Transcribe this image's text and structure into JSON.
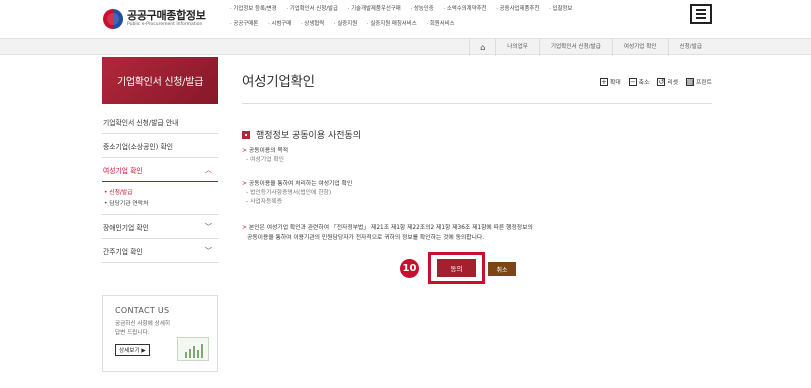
{
  "header": {
    "logo_kr": "공공구매종합정보",
    "logo_en": "Public e-Procurement Information",
    "gnb_row1": [
      "· 기업정보 등록/변경",
      "· 기업확인서 신청/발급",
      "· 기술개발제품우선구매",
      "· 성능인증",
      "· 소액수의계약추천",
      "· 공동사업제품추천",
      "· 입찰정보"
    ],
    "gnb_row2": [
      "· 공공구매론",
      "· 시범구매",
      "· 상생협력",
      "· 실증지원",
      "· 실증지원 매칭서비스",
      "· 회원서비스"
    ]
  },
  "breadcrumb": [
    "나의업무",
    "기업확인서 신청/발급",
    "여성기업 확인",
    "신청/발급"
  ],
  "sidebar": {
    "title": "기업확인서 신청/발급",
    "items": [
      {
        "label": "기업확인서 신청/발급 안내"
      },
      {
        "label": "중소기업(소상공인) 확인"
      },
      {
        "label": "여성기업 확인"
      },
      {
        "label": "장애인기업 확인"
      },
      {
        "label": "간주기업 확인"
      }
    ],
    "sub_items": [
      "• 신청/발급",
      "• 담당기관 연락처"
    ]
  },
  "contact": {
    "title": "CONTACT US",
    "desc": "궁금하신 사항에 상세히 답변 드립니다.",
    "button": "상세보기 ▶"
  },
  "main": {
    "title": "여성기업확인",
    "tools": [
      "확대",
      "축소",
      "리셋",
      "프린트"
    ],
    "section_title": "행정정보 공동이용 사전동의",
    "purpose_head": "공동이용의 목적",
    "purpose_detail": "여성기업 확인",
    "info_head": "공동이용을 통하여 처리하는 여성기업 확인",
    "info_detail_1": "법인등기사항증명서(법인에 한함)",
    "info_detail_2": "사업자등록증",
    "consent_line1": "본인은 여성기업 확인과 관련하여 「전자정부법」 제21조 제1항 제22조의2 제1항 제36조 제1항에 따른 행정정보의",
    "consent_line2": "공동이용을 통하여 이용기관의 민원담당자가 전자적으로 귀하의 정보를 확인하는 것에 동의합니다.",
    "step_number": "10",
    "agree_label": "동의",
    "cancel_label": "취소"
  },
  "colors": {
    "brand_red": "#c8102e",
    "agree_button": "#a5202e",
    "cancel_button": "#7a4614"
  }
}
